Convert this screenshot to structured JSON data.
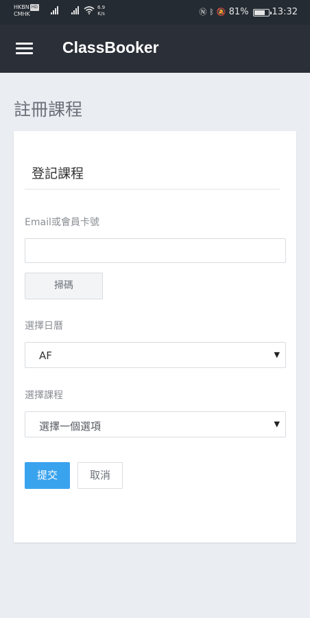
{
  "status_bar": {
    "carrier_line1": "HKBN",
    "carrier_badge": "HD",
    "carrier_line2": "CMHK",
    "speed_value": "6.9",
    "speed_unit": "K/s",
    "battery_percent": "81%",
    "battery_level": 0.81,
    "time": "13:32",
    "icons": [
      "nfc-icon",
      "bluetooth-icon",
      "mute-icon",
      "battery-icon"
    ]
  },
  "app_bar": {
    "title": "ClassBooker",
    "menu_icon": "hamburger-menu-icon"
  },
  "page": {
    "title": "註冊課程"
  },
  "form": {
    "title": "登記課程",
    "email_label": "Email或會員卡號",
    "email_value": "",
    "scan_button": "掃碼",
    "calendar_label": "選擇日曆",
    "calendar_selected": "AF",
    "course_label": "選擇課程",
    "course_selected": "選擇一個選項",
    "submit_button": "提交",
    "cancel_button": "取消"
  },
  "colors": {
    "status_bar_bg": "#242b32",
    "app_bar_bg": "#2b3038",
    "page_bg": "#eaedf2",
    "primary": "#3aa3ee"
  }
}
